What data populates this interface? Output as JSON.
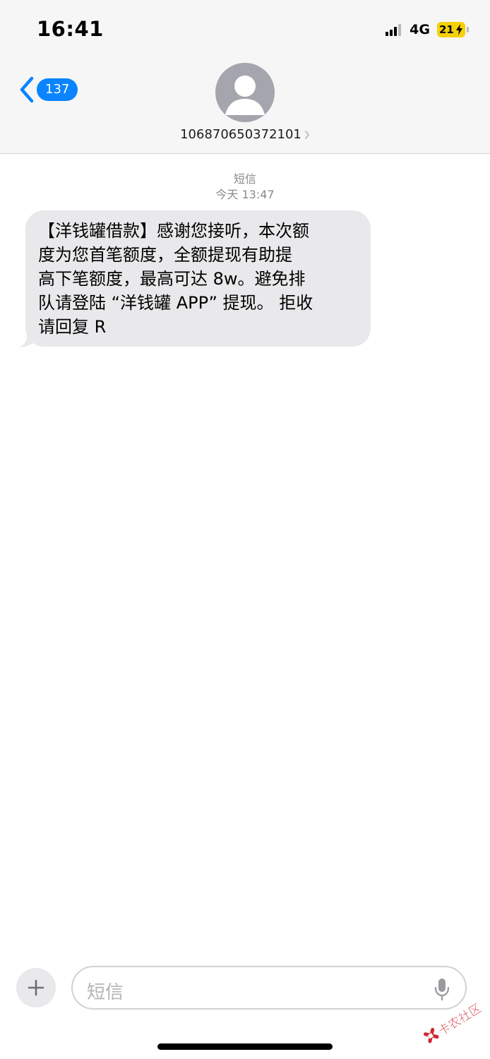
{
  "status_bar": {
    "time": "16:41",
    "network": "4G",
    "battery": "21"
  },
  "nav": {
    "back_count": "137",
    "sender_number": "106870650372101"
  },
  "thread": {
    "service_label": "短信",
    "timestamp": "今天 13:47"
  },
  "messages": [
    {
      "direction": "incoming",
      "text": "【洋钱罐借款】感谢您接听，本次额\n度为您首笔额度，全额提现有助提\n高下笔额度，最高可达 8w。避免排\n队请登陆 “洋钱罐 APP” 提现。 拒收\n请回复 R"
    }
  ],
  "composer": {
    "placeholder": "短信"
  },
  "watermark": {
    "text": "卡农社区"
  },
  "colors": {
    "accent": "#0a84ff",
    "bubble_incoming": "#e9e9eb",
    "battery_low": "#f5d10a",
    "header_bg": "#f6f6f6"
  },
  "icons": [
    "back-chevron-icon",
    "contact-avatar-icon",
    "chevron-right-icon",
    "plus-icon",
    "microphone-icon",
    "signal-icon",
    "battery-icon",
    "charging-bolt-icon"
  ]
}
